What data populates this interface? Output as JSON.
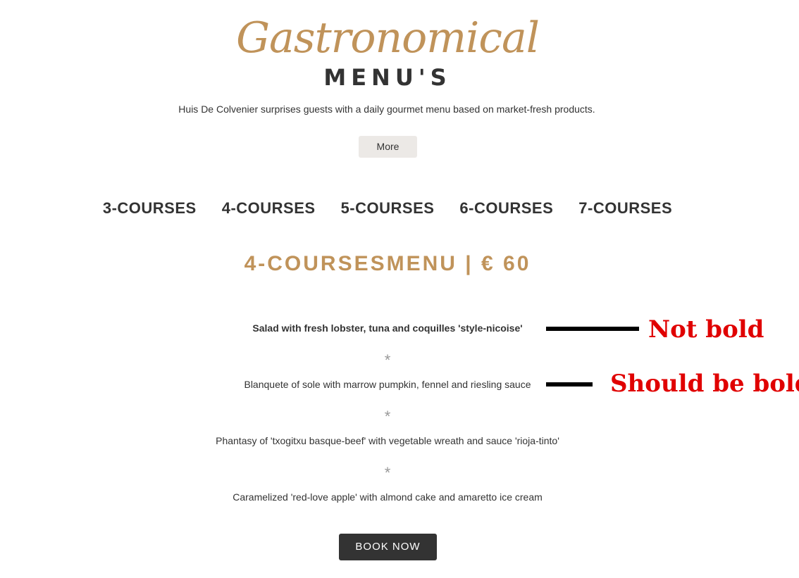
{
  "header": {
    "script_title": "Gastronomical",
    "title": "MENU'S",
    "intro": "Huis De Colvenier surprises guests with a daily gourmet menu based on market-fresh products.",
    "more_label": "More"
  },
  "tabs": [
    {
      "label": "3-COURSES"
    },
    {
      "label": "4-COURSES"
    },
    {
      "label": "5-COURSES"
    },
    {
      "label": "6-COURSES"
    },
    {
      "label": "7-COURSES"
    }
  ],
  "menu": {
    "heading": "4-COURSESMENU | € 60",
    "separator": "*",
    "courses": [
      {
        "text": "Salad with fresh lobster, tuna and coquilles 'style-nicoise'",
        "bold": true
      },
      {
        "text": "Blanquete of sole with marrow pumpkin, fennel and riesling sauce",
        "bold": false
      },
      {
        "text": "Phantasy of 'txogitxu basque-beef' with vegetable wreath and sauce 'rioja-tinto'",
        "bold": false
      },
      {
        "text": "Caramelized 'red-love apple' with almond cake and amaretto ice cream",
        "bold": false
      }
    ],
    "book_label": "BOOK NOW"
  },
  "annotations": {
    "not_bold": "Not bold",
    "should_be_bold": "Should be bold",
    "color": "#e00000"
  },
  "colors": {
    "accent_gold": "#c0935a",
    "text_dark": "#333333",
    "button_light": "#ece9e6",
    "button_dark": "#333333"
  }
}
